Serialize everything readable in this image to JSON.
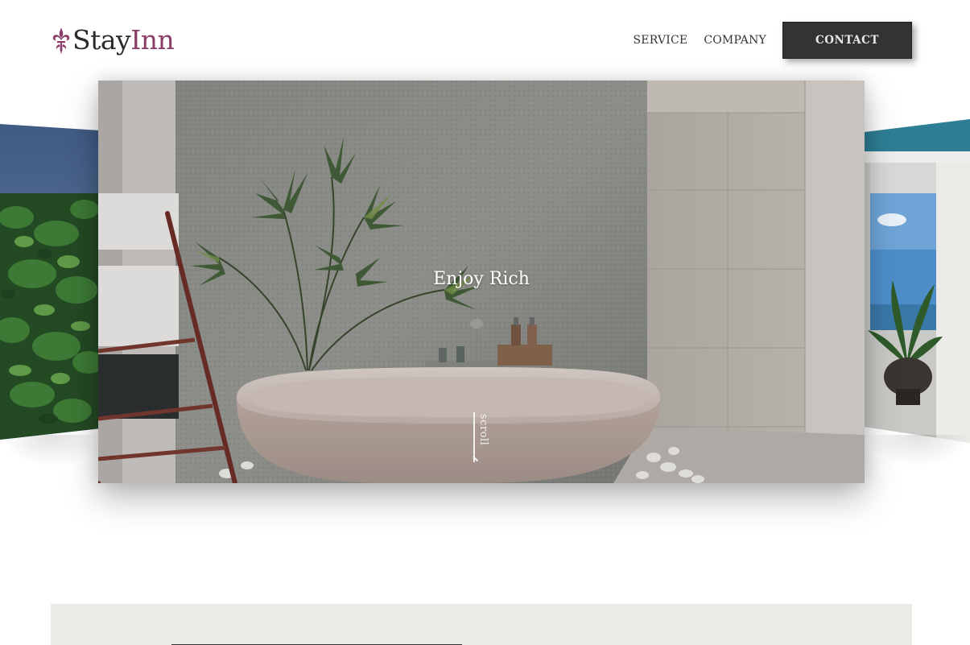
{
  "brand": {
    "name_part1": "Stay",
    "name_part2": "Inn",
    "accent_color": "#8a3d68"
  },
  "nav": {
    "service": "SERVICE",
    "company": "COMPANY",
    "contact": "CONTACT"
  },
  "hero": {
    "title": "Enjoy Rich",
    "scroll_label": "scroll"
  },
  "colors": {
    "button_bg": "#333333",
    "lower_section_bg": "#eaeae6"
  }
}
